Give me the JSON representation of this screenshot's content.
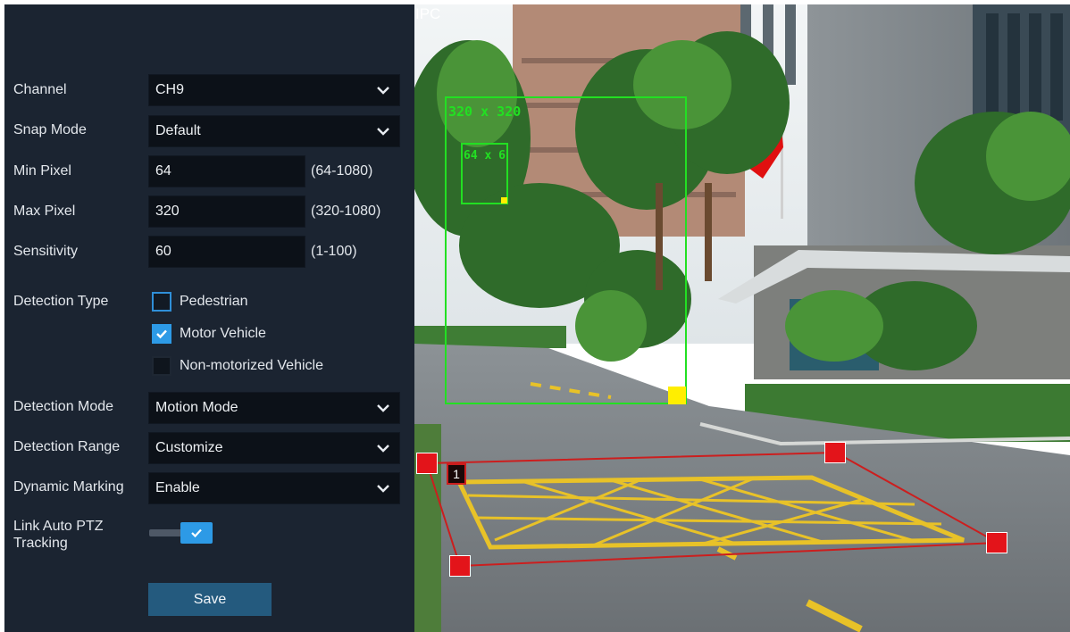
{
  "settings": {
    "channel": {
      "label": "Channel",
      "value": "CH9"
    },
    "snap_mode": {
      "label": "Snap Mode",
      "value": "Default"
    },
    "min_pixel": {
      "label": "Min Pixel",
      "value": "64",
      "range": "(64-1080)"
    },
    "max_pixel": {
      "label": "Max Pixel",
      "value": "320",
      "range": "(320-1080)"
    },
    "sensitivity": {
      "label": "Sensitivity",
      "value": "60",
      "range": "(1-100)"
    },
    "detection_type": {
      "label": "Detection Type",
      "options": [
        {
          "label": "Pedestrian",
          "checked": false
        },
        {
          "label": "Motor Vehicle",
          "checked": true
        },
        {
          "label": "Non-motorized Vehicle",
          "checked": false
        }
      ]
    },
    "detection_mode": {
      "label": "Detection Mode",
      "value": "Motion Mode"
    },
    "detection_range": {
      "label": "Detection Range",
      "value": "Customize"
    },
    "dynamic_marking": {
      "label": "Dynamic Marking",
      "value": "Enable"
    },
    "link_auto_ptz": {
      "label": "Link Auto PTZ Tracking",
      "enabled": true
    },
    "save_label": "Save"
  },
  "camera": {
    "overlay_label": "IPC",
    "max_box_label": "320 x 320",
    "min_box_label": "64 x 6",
    "zone_number": "1",
    "colors": {
      "detection_box": "#22e022",
      "resize_handle": "#ffee00",
      "zone_line": "#cc1e1e",
      "zone_handle": "#e3141a",
      "accent": "#2d9ae6"
    }
  },
  "icons": {
    "dropdown": "chevron-down-icon",
    "checkbox_checked": "check-icon",
    "toggle": "check-icon"
  }
}
